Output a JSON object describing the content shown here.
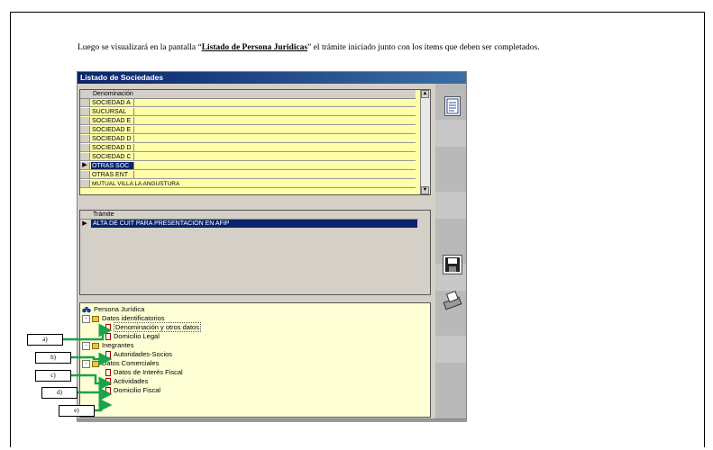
{
  "intro": {
    "before": "Luego se visualizará en la pantalla “",
    "highlight": "Listado de Persona Juridicas",
    "after": "” el trámite iniciado junto con los ítems que deben ser completados."
  },
  "window": {
    "title": "Listado de Sociedades",
    "societies": {
      "header": "Denominación",
      "rows": [
        "SOCIEDAD A",
        "SUCURSAL",
        "SOCIEDAD E",
        "SOCIEDAD E",
        "SOCIEDAD D",
        "SOCIEDAD D",
        "SOCIEDAD C",
        "OTRAS SOC",
        "OTRAS ENT",
        "MUTUAL VILLA LA ANGUSTURA"
      ],
      "selected_row_index": 7,
      "row_indicator": "▶"
    },
    "tramite": {
      "header": "Trámite",
      "row": "ALTA DE CUIT PARA PRESENTACION EN AFIP",
      "row_indicator": "▶"
    },
    "tree": {
      "root": "Persona Jurídica",
      "groups": [
        {
          "label": "Datos identificatorios",
          "items": [
            "Denominación y otros datos",
            "Domicilio Legal"
          ]
        },
        {
          "label": "Inegrantes",
          "items": [
            "Autoridades-Socios"
          ]
        },
        {
          "label": "Datos Comerciales",
          "items": [
            "Datos de Interés Fiscal",
            "Actividades",
            "Domicilio Fiscal"
          ]
        }
      ],
      "expander": "-"
    },
    "toolbar_icons": [
      "document-icon",
      "save-icon",
      "printer-icon"
    ]
  },
  "annotations": [
    "a)",
    "b)",
    "c)",
    "d)",
    "e)"
  ],
  "colors": {
    "title_bar": "#0a246a",
    "grid_background": "#ffffa8",
    "tree_background": "#ffffd6",
    "arrow": "#1aa34a"
  }
}
